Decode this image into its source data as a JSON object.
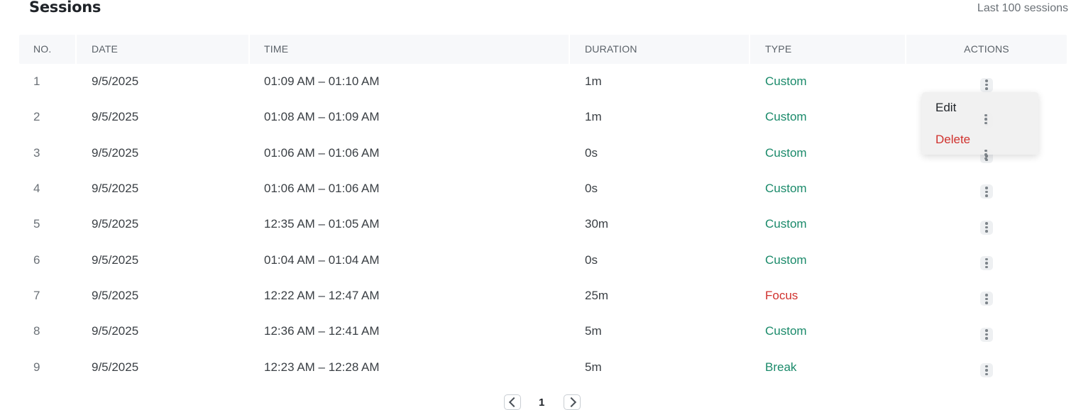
{
  "header": {
    "title": "Sessions",
    "subtitle": "Last 100 sessions"
  },
  "table": {
    "columns": [
      "NO.",
      "DATE",
      "TIME",
      "DURATION",
      "TYPE",
      "ACTIONS"
    ],
    "rows": [
      {
        "no": "1",
        "date": "9/5/2025",
        "time": "01:09 AM – 01:10 AM",
        "duration": "1m",
        "type": "Custom"
      },
      {
        "no": "2",
        "date": "9/5/2025",
        "time": "01:08 AM – 01:09 AM",
        "duration": "1m",
        "type": "Custom"
      },
      {
        "no": "3",
        "date": "9/5/2025",
        "time": "01:06 AM – 01:06 AM",
        "duration": "0s",
        "type": "Custom"
      },
      {
        "no": "4",
        "date": "9/5/2025",
        "time": "01:06 AM – 01:06 AM",
        "duration": "0s",
        "type": "Custom"
      },
      {
        "no": "5",
        "date": "9/5/2025",
        "time": "12:35 AM – 01:05 AM",
        "duration": "30m",
        "type": "Custom"
      },
      {
        "no": "6",
        "date": "9/5/2025",
        "time": "01:04 AM – 01:04 AM",
        "duration": "0s",
        "type": "Custom"
      },
      {
        "no": "7",
        "date": "9/5/2025",
        "time": "12:22 AM – 12:47 AM",
        "duration": "25m",
        "type": "Focus"
      },
      {
        "no": "8",
        "date": "9/5/2025",
        "time": "12:36 AM – 12:41 AM",
        "duration": "5m",
        "type": "Custom"
      },
      {
        "no": "9",
        "date": "9/5/2025",
        "time": "12:23 AM – 12:28 AM",
        "duration": "5m",
        "type": "Break"
      }
    ]
  },
  "context_menu": {
    "edit_label": "Edit",
    "delete_label": "Delete"
  },
  "pagination": {
    "current_page": "1"
  },
  "colors": {
    "custom": "#1a8a6a",
    "focus": "#d0312d",
    "break": "#1a8a6a",
    "delete": "#d0312d"
  },
  "icons": {
    "row_action": "more-vertical-icon",
    "prev": "chevron-left-icon",
    "next": "chevron-right-icon"
  }
}
